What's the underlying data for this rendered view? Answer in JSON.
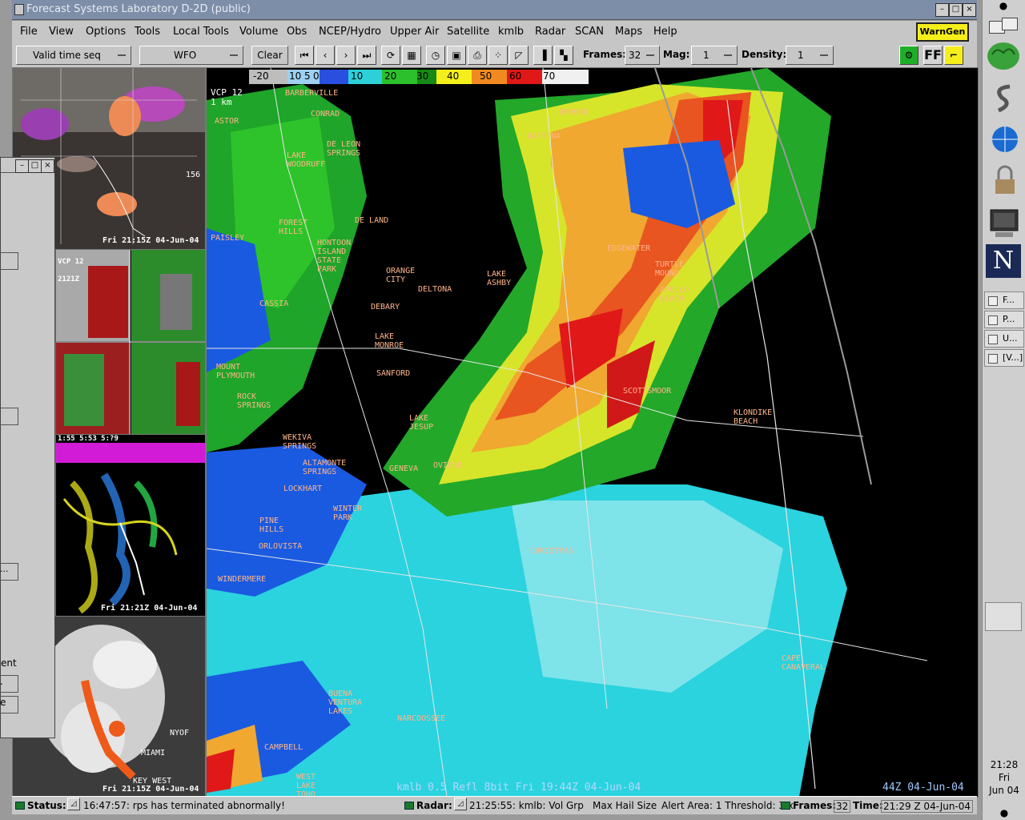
{
  "window": {
    "title": "Forecast Systems Laboratory D-2D (public)"
  },
  "menus": [
    "File",
    "View",
    "Options",
    "Tools",
    "Local Tools",
    "Volume",
    "Obs",
    "NCEP/Hydro",
    "Upper Air",
    "Satellite",
    "kmlb",
    "Radar",
    "SCAN",
    "Maps",
    "Help"
  ],
  "warngen_label": "WarnGen",
  "toolbar": {
    "time_mode": "Valid time seq",
    "scale": "WFO",
    "clear_label": "Clear",
    "frames_label": "Frames:",
    "frames_value": "32",
    "mag_label": "Mag:",
    "mag_value": "1",
    "density_label": "Density:",
    "density_value": "1",
    "ff_label": "FF"
  },
  "colors": {
    "accent_yellow": "#f4ef1a",
    "radar_bg": "#000000",
    "chrome": "#c6c6c6"
  },
  "main_radar": {
    "colorbar_values": [
      "-20",
      "10",
      "5",
      "0",
      "10",
      "20",
      "30",
      "40",
      "50",
      "60",
      "70"
    ],
    "vcp": "VCP 12",
    "range": "1 km",
    "caption": "kmlb 0.5 Refl  8bit Fri 19:44Z 04-Jun-04",
    "caption2": "44Z 04-Jun-04",
    "places": [
      "BARBERVILLE",
      "CONRAD",
      "ASTOR",
      "DE LEON SPRINGS",
      "LAKE WOODRUFF",
      "PAISLEY",
      "FOREST HILLS",
      "DE LAND",
      "HONTOON ISLAND STATE PARK",
      "ORANGE CITY",
      "DEBARY",
      "CASSIA",
      "LAKE MONROE",
      "MOUNT PLYMOUTH",
      "ROCK SPRINGS",
      "SANFORD",
      "LAKE JESUP",
      "WEKIVA SPRINGS",
      "ALTAMONTE SPRINGS",
      "LOCKHART",
      "WINTER PARK",
      "PINE HILLS",
      "ORLOVISTA",
      "WINDERMERE",
      "OVIEDO",
      "CHRISTMAS",
      "KLONDIKE BEACH",
      "TURTLE MOUND",
      "APOLLO BEACH",
      "EDGEWATER",
      "ORMOND",
      "DAYTONA",
      "BUENA VENTURA LAKES",
      "NARCOOSSEE",
      "CAMPBELL",
      "WEST LAKE TOHO",
      "CAPE CANAVERAL",
      "LAKE ASHBY",
      "SCOTTSMOOR",
      "DELTONA",
      "GENEVA"
    ]
  },
  "mini_panels": {
    "satellite_time": "Fri 21:15Z 04-Jun-04",
    "radar_quad_vcp": "VCP 12",
    "radar_quad_time": "2121Z",
    "lightning_time": "Fri 21:21Z 04-Jun-04",
    "lightning_header": "1:55  5:53  5:?9",
    "ir_time": "Fri 21:15Z 04-Jun-04",
    "ir_places": [
      "MIAMI",
      "KEY WEST",
      "NYOF"
    ],
    "sat_labels": [
      "156"
    ]
  },
  "left_window": {
    "text1": "ent",
    "btn1": ".",
    "btn2": "e",
    "btn3": "..."
  },
  "status": {
    "status_label": "Status:",
    "status_msg": "16:47:57: rps has terminated abnormally!",
    "radar_label": "Radar:",
    "radar_msg": "21:25:55: kmlb: Vol Grp",
    "hail_label": "Max Hail Size",
    "alert_label": "Alert Area: 1 Threshold: 3 x",
    "frames_label": "Frames:",
    "frames_value": "32",
    "time_label": "Time:",
    "time_value": "21:29 Z 04-Jun-04"
  },
  "dock": {
    "windows": [
      "F...",
      "P...",
      "U...",
      "[V...]"
    ],
    "clock_time": "21:28",
    "clock_day": "Fri",
    "clock_date": "Jun 04"
  }
}
